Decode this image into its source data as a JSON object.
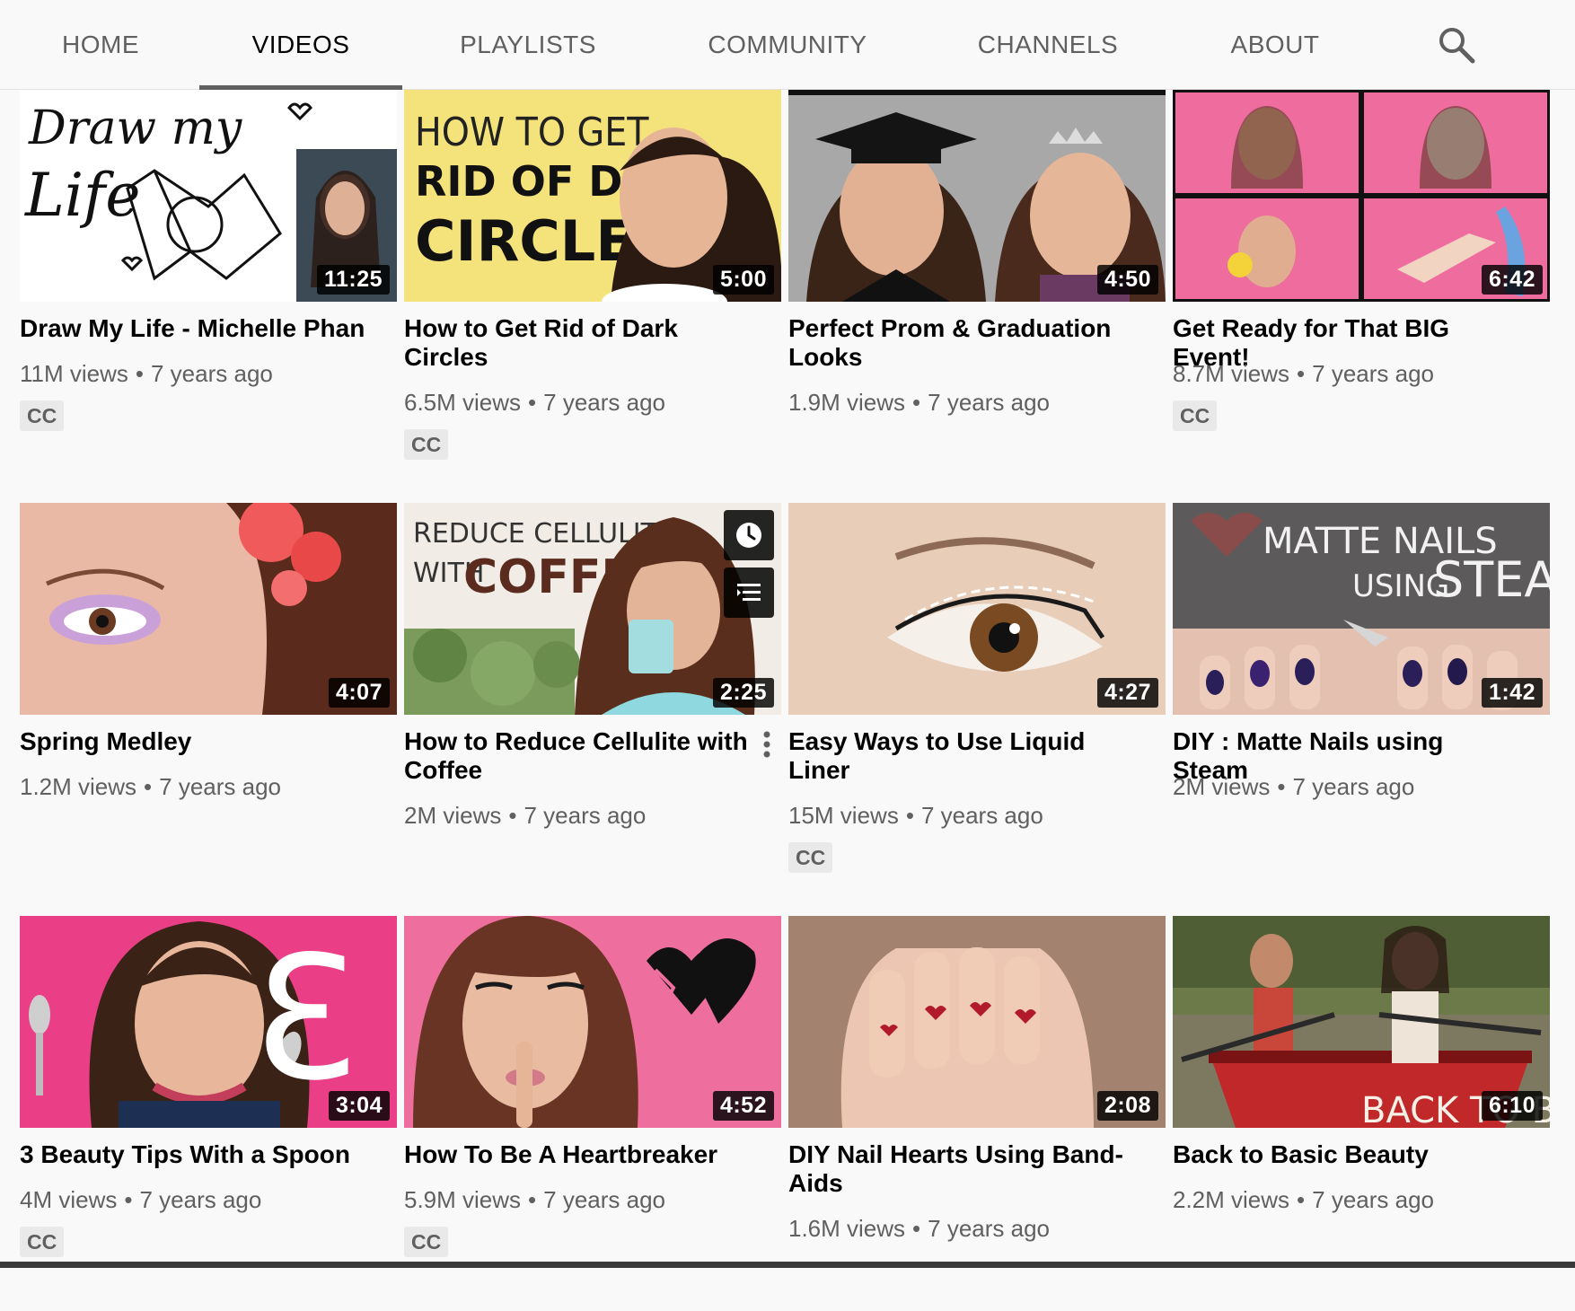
{
  "tabs": [
    {
      "label": "HOME",
      "active": false
    },
    {
      "label": "VIDEOS",
      "active": true
    },
    {
      "label": "PLAYLISTS",
      "active": false
    },
    {
      "label": "COMMUNITY",
      "active": false
    },
    {
      "label": "CHANNELS",
      "active": false
    },
    {
      "label": "ABOUT",
      "active": false
    }
  ],
  "search": {
    "icon": "search-icon"
  },
  "videos": [
    {
      "title": "Draw My Life - Michelle Phan",
      "views": "11M views",
      "age": "7 years ago",
      "cc": "CC",
      "duration": "11:25",
      "thumb_text": [
        "Draw my",
        "Life"
      ]
    },
    {
      "title": "How to Get Rid of Dark Circles",
      "views": "6.5M views",
      "age": "7 years ago",
      "cc": "CC",
      "duration": "5:00",
      "thumb_text": [
        "HOW TO GET",
        "RID OF DARK",
        "CIRCLES"
      ]
    },
    {
      "title": "Perfect Prom & Graduation Looks",
      "views": "1.9M views",
      "age": "7 years ago",
      "cc": null,
      "duration": "4:50"
    },
    {
      "title": "Get Ready for That BIG Event!",
      "views": "8.7M views",
      "age": "7 years ago",
      "cc": "CC",
      "duration": "6:42"
    },
    {
      "title": "Spring Medley",
      "views": "1.2M views",
      "age": "7 years ago",
      "cc": null,
      "duration": "4:07"
    },
    {
      "title": "How to Reduce Cellulite with Coffee",
      "views": "2M views",
      "age": "7 years ago",
      "cc": null,
      "duration": "2:25",
      "hovered": true,
      "thumb_text": [
        "REDUCE CELLULITE",
        "WITH",
        "COFFEE"
      ]
    },
    {
      "title": "Easy Ways to Use Liquid Liner",
      "views": "15M views",
      "age": "7 years ago",
      "cc": "CC",
      "duration": "4:27"
    },
    {
      "title": "DIY : Matte Nails using Steam",
      "views": "2M views",
      "age": "7 years ago",
      "cc": null,
      "duration": "1:42",
      "thumb_text": [
        "MATTE NAILS",
        "USING",
        "STEAM"
      ]
    },
    {
      "title": "3 Beauty Tips With a Spoon",
      "views": "4M views",
      "age": "7 years ago",
      "cc": "CC",
      "duration": "3:04",
      "thumb_text": [
        "3"
      ]
    },
    {
      "title": "How To Be A Heartbreaker",
      "views": "5.9M views",
      "age": "7 years ago",
      "cc": "CC",
      "duration": "4:52"
    },
    {
      "title": "DIY Nail Hearts Using Band-Aids",
      "views": "1.6M views",
      "age": "7 years ago",
      "cc": null,
      "duration": "2:08"
    },
    {
      "title": "Back to Basic Beauty",
      "views": "2.2M views",
      "age": "7 years ago",
      "cc": null,
      "duration": "6:10",
      "thumb_text": [
        "BACK TO B"
      ]
    }
  ],
  "colors": {
    "background": "#f9f9f9",
    "title": "#030303",
    "meta": "#606060",
    "badge_bg": "#e9e9e9"
  }
}
